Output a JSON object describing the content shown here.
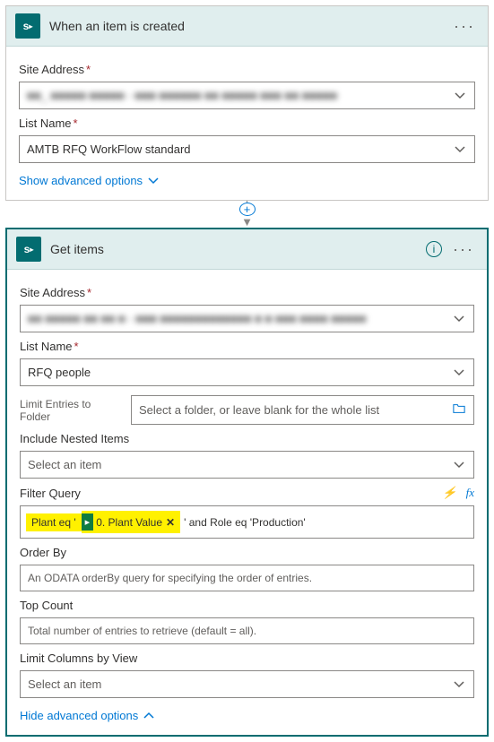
{
  "trigger": {
    "icon_letter": "s",
    "title": "When an item is created",
    "fields": {
      "site_address_label": "Site Address",
      "site_address_value": "■■_ ■■■■■ ■■■■■ - ■■■ ■■■■■■ ■■ ■■■■■ ■■■ ■■ ■■■■■",
      "list_name_label": "List Name",
      "list_name_value": "AMTB RFQ WorkFlow standard"
    },
    "advanced_link": "Show advanced options"
  },
  "action": {
    "icon_letter": "s",
    "title": "Get items",
    "fields": {
      "site_address_label": "Site Address",
      "site_address_value": "■■ ■■■■■ ■■ ■■ ■ - ■■■ ■■■■■■■■■■■■■ ■ ■ ■■■ ■■■■ ■■■■■",
      "list_name_label": "List Name",
      "list_name_value": "RFQ people",
      "folder_label": "Limit Entries to Folder",
      "folder_placeholder": "Select a folder, or leave blank for the whole list",
      "nested_label": "Include Nested Items",
      "nested_placeholder": "Select an item",
      "filter_label": "Filter Query",
      "filter_token_prefix": "Plant eq '",
      "filter_token_dyn": "0. Plant Value",
      "filter_suffix": "' and Role eq 'Production'",
      "orderby_label": "Order By",
      "orderby_placeholder": "An ODATA orderBy query for specifying the order of entries.",
      "top_label": "Top Count",
      "top_placeholder": "Total number of entries to retrieve (default = all).",
      "limitcol_label": "Limit Columns by View",
      "limitcol_placeholder": "Select an item"
    },
    "advanced_link": "Hide advanced options"
  }
}
